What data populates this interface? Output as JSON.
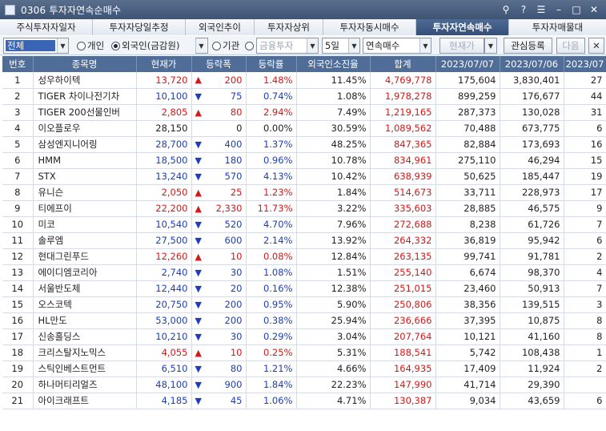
{
  "window": {
    "title": "0306 투자자연속순매수"
  },
  "tabs": [
    {
      "label": "주식투자자일자",
      "active": false
    },
    {
      "label": "투자자당일추정",
      "active": false
    },
    {
      "label": "외국인추이",
      "active": false
    },
    {
      "label": "투자자상위",
      "active": false
    },
    {
      "label": "투자자동시매수",
      "active": false
    },
    {
      "label": "투자자연속매수",
      "active": true
    },
    {
      "label": "투자자매물대",
      "active": false
    }
  ],
  "toolbar": {
    "market_select": "전체",
    "radio_individual": "개인",
    "radio_foreign": "외국인(금감원)",
    "radio_institution": "기관",
    "institution_select": "금융투자",
    "period_select": "5일",
    "mode_select": "연속매수",
    "price_button": "현재가",
    "watchlist_button": "관심등록",
    "next_button": "다음",
    "close_button": "✕"
  },
  "columns": [
    "번호",
    "종목명",
    "현재가",
    "등락폭",
    "등락률",
    "외국인소진율",
    "합계",
    "2023/07/07",
    "2023/07/06",
    "2023/07"
  ],
  "colors": {
    "up": "#d11a1a",
    "down": "#1e3fb2",
    "header": "#4f6d97",
    "active_tab": "#34507a"
  },
  "rows": [
    {
      "no": "1",
      "name": "성우하이텍",
      "price": "13,720",
      "dir": "up",
      "change": "200",
      "rate": "1.48%",
      "foreign": "11.45%",
      "total": "4,769,778",
      "d1": "175,604",
      "d2": "3,830,401",
      "d3": "27"
    },
    {
      "no": "2",
      "name": "TIGER 차이나전기차",
      "price": "10,100",
      "dir": "down",
      "change": "75",
      "rate": "0.74%",
      "foreign": "1.08%",
      "total": "1,978,278",
      "d1": "899,259",
      "d2": "176,677",
      "d3": "44"
    },
    {
      "no": "3",
      "name": "TIGER 200선물인버",
      "price": "2,805",
      "dir": "up",
      "change": "80",
      "rate": "2.94%",
      "foreign": "7.49%",
      "total": "1,219,165",
      "d1": "287,373",
      "d2": "130,028",
      "d3": "31"
    },
    {
      "no": "4",
      "name": "이오플로우",
      "price": "28,150",
      "dir": "flat",
      "change": "0",
      "rate": "0.00%",
      "foreign": "30.59%",
      "total": "1,089,562",
      "d1": "70,488",
      "d2": "673,775",
      "d3": "6"
    },
    {
      "no": "5",
      "name": "삼성엔지니어링",
      "price": "28,700",
      "dir": "down",
      "change": "400",
      "rate": "1.37%",
      "foreign": "48.25%",
      "total": "847,365",
      "d1": "82,884",
      "d2": "173,693",
      "d3": "16"
    },
    {
      "no": "6",
      "name": "HMM",
      "price": "18,500",
      "dir": "down",
      "change": "180",
      "rate": "0.96%",
      "foreign": "10.78%",
      "total": "834,961",
      "d1": "275,110",
      "d2": "46,294",
      "d3": "15"
    },
    {
      "no": "7",
      "name": "STX",
      "price": "13,240",
      "dir": "down",
      "change": "570",
      "rate": "4.13%",
      "foreign": "10.42%",
      "total": "638,939",
      "d1": "50,625",
      "d2": "185,447",
      "d3": "19"
    },
    {
      "no": "8",
      "name": "유니슨",
      "price": "2,050",
      "dir": "up",
      "change": "25",
      "rate": "1.23%",
      "foreign": "1.84%",
      "total": "514,673",
      "d1": "33,711",
      "d2": "228,973",
      "d3": "17"
    },
    {
      "no": "9",
      "name": "티에프이",
      "price": "22,200",
      "dir": "up",
      "change": "2,330",
      "rate": "11.73%",
      "foreign": "3.22%",
      "total": "335,603",
      "d1": "28,885",
      "d2": "46,575",
      "d3": "9"
    },
    {
      "no": "10",
      "name": "미코",
      "price": "10,540",
      "dir": "down",
      "change": "520",
      "rate": "4.70%",
      "foreign": "7.96%",
      "total": "272,688",
      "d1": "8,238",
      "d2": "61,726",
      "d3": "7"
    },
    {
      "no": "11",
      "name": "솔루엠",
      "price": "27,500",
      "dir": "down",
      "change": "600",
      "rate": "2.14%",
      "foreign": "13.92%",
      "total": "264,332",
      "d1": "36,819",
      "d2": "95,942",
      "d3": "6"
    },
    {
      "no": "12",
      "name": "현대그린푸드",
      "price": "12,260",
      "dir": "up",
      "change": "10",
      "rate": "0.08%",
      "foreign": "12.84%",
      "total": "263,135",
      "d1": "99,741",
      "d2": "91,781",
      "d3": "2"
    },
    {
      "no": "13",
      "name": "에이디엠코리아",
      "price": "2,740",
      "dir": "down",
      "change": "30",
      "rate": "1.08%",
      "foreign": "1.51%",
      "total": "255,140",
      "d1": "6,674",
      "d2": "98,370",
      "d3": "4"
    },
    {
      "no": "14",
      "name": "서울반도체",
      "price": "12,440",
      "dir": "down",
      "change": "20",
      "rate": "0.16%",
      "foreign": "12.38%",
      "total": "251,015",
      "d1": "23,460",
      "d2": "50,913",
      "d3": "7"
    },
    {
      "no": "15",
      "name": "오스코텍",
      "price": "20,750",
      "dir": "down",
      "change": "200",
      "rate": "0.95%",
      "foreign": "5.90%",
      "total": "250,806",
      "d1": "38,356",
      "d2": "139,515",
      "d3": "3"
    },
    {
      "no": "16",
      "name": "HL만도",
      "price": "53,000",
      "dir": "down",
      "change": "200",
      "rate": "0.38%",
      "foreign": "25.94%",
      "total": "236,666",
      "d1": "37,395",
      "d2": "10,875",
      "d3": "8"
    },
    {
      "no": "17",
      "name": "신송홀딩스",
      "price": "10,210",
      "dir": "down",
      "change": "30",
      "rate": "0.29%",
      "foreign": "3.04%",
      "total": "207,764",
      "d1": "10,121",
      "d2": "41,160",
      "d3": "8"
    },
    {
      "no": "18",
      "name": "크리스탈지노믹스",
      "price": "4,055",
      "dir": "up",
      "change": "10",
      "rate": "0.25%",
      "foreign": "5.31%",
      "total": "188,541",
      "d1": "5,742",
      "d2": "108,438",
      "d3": "1"
    },
    {
      "no": "19",
      "name": "스틱인베스트먼트",
      "price": "6,510",
      "dir": "down",
      "change": "80",
      "rate": "1.21%",
      "foreign": "4.66%",
      "total": "164,935",
      "d1": "17,409",
      "d2": "11,924",
      "d3": "2"
    },
    {
      "no": "20",
      "name": "하나머티리얼즈",
      "price": "48,100",
      "dir": "down",
      "change": "900",
      "rate": "1.84%",
      "foreign": "22.23%",
      "total": "147,990",
      "d1": "41,714",
      "d2": "29,390",
      "d3": ""
    },
    {
      "no": "21",
      "name": "아이크래프트",
      "price": "4,185",
      "dir": "down",
      "change": "45",
      "rate": "1.06%",
      "foreign": "4.71%",
      "total": "130,387",
      "d1": "9,034",
      "d2": "43,659",
      "d3": "6"
    }
  ]
}
